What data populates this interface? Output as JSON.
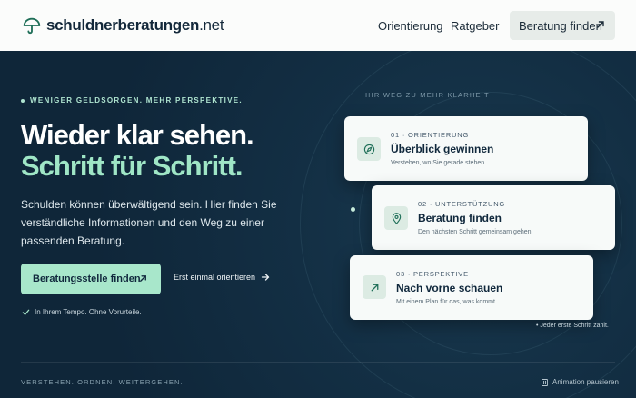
{
  "brand": {
    "name_bold": "schuldnerberatungen",
    "name_suffix": ".net"
  },
  "nav": {
    "items": [
      "Orientierung",
      "Ratgeber"
    ],
    "cta": "Beratung finden"
  },
  "hero": {
    "eyebrow": "WENIGER GELDSORGEN. MEHR PERSPEKTIVE.",
    "headline_line1": "Wieder klar sehen.",
    "headline_line2": "Schritt für Schritt.",
    "lead": "Schulden können überwältigend sein. Hier finden Sie verständliche Informationen und den Weg zu einer passenden Beratung.",
    "primary_cta": "Beratungsstelle finden",
    "secondary_cta": "Erst einmal orientieren",
    "note": "In Ihrem Tempo. Ohne Vorurteile."
  },
  "path": {
    "label": "IHR WEG ZU MEHR KLARHEIT",
    "steps": [
      {
        "step": "01 · ORIENTIERUNG",
        "title": "Überblick gewinnen",
        "subtitle": "Verstehen, wo Sie gerade stehen.",
        "icon": "compass-icon"
      },
      {
        "step": "02 · UNTERSTÜTZUNG",
        "title": "Beratung finden",
        "subtitle": "Den nächsten Schritt gemeinsam gehen.",
        "icon": "map-pin-icon"
      },
      {
        "step": "03 · PERSPEKTIVE",
        "title": "Nach vorne schauen",
        "subtitle": "Mit einem Plan für das, was kommt.",
        "icon": "arrow-up-right-icon"
      }
    ],
    "footnote": "• Jeder erste Schritt zählt."
  },
  "footer": {
    "tagline": "VERSTEHEN. ORDNEN. WEITERGEHEN.",
    "pause_label": "Animation pausieren"
  },
  "colors": {
    "accent": "#a8e7cb",
    "background": "#10283c",
    "header_bg": "#fbfcfb"
  }
}
